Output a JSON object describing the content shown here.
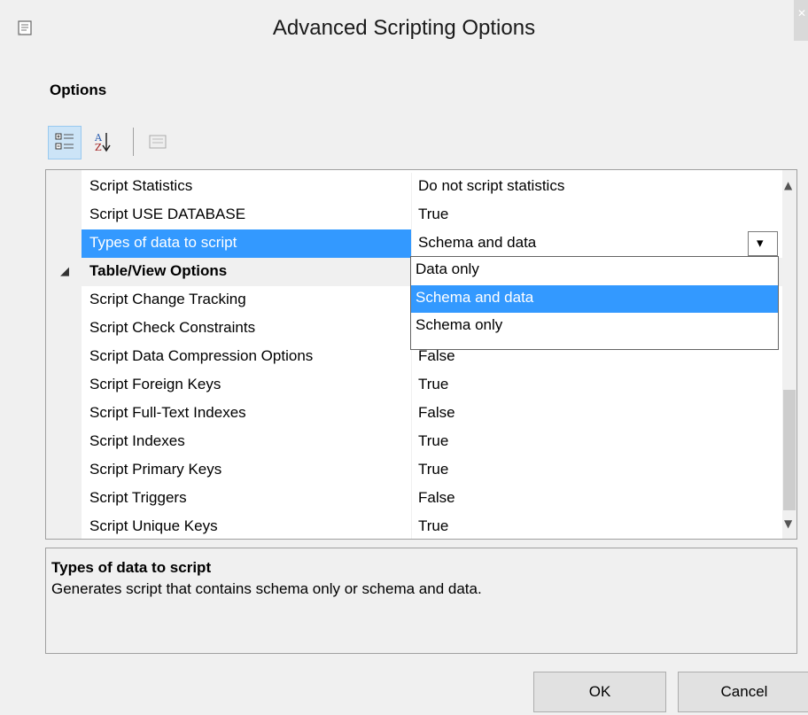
{
  "window": {
    "title": "Advanced Scripting Options"
  },
  "options_label": "Options",
  "toolbar": {
    "categorized_icon": "categorized-view-icon",
    "alphabetical_icon": "alphabetical-sort-icon",
    "property_pages_icon": "property-pages-icon"
  },
  "rows": [
    {
      "name": "Script Statistics",
      "value": "Do not script statistics"
    },
    {
      "name": "Script USE DATABASE",
      "value": "True"
    },
    {
      "name": "Types of data to script",
      "value": "Schema and data"
    },
    {
      "name": "Table/View Options",
      "value": ""
    },
    {
      "name": "Script Change Tracking",
      "value": ""
    },
    {
      "name": "Script Check Constraints",
      "value": ""
    },
    {
      "name": "Script Data Compression Options",
      "value": "False"
    },
    {
      "name": "Script Foreign Keys",
      "value": "True"
    },
    {
      "name": "Script Full-Text Indexes",
      "value": "False"
    },
    {
      "name": "Script Indexes",
      "value": "True"
    },
    {
      "name": "Script Primary Keys",
      "value": "True"
    },
    {
      "name": "Script Triggers",
      "value": "False"
    },
    {
      "name": "Script Unique Keys",
      "value": "True"
    }
  ],
  "dropdown": {
    "options": [
      "Data only",
      "Schema and data",
      "Schema only"
    ],
    "selected": "Schema and data"
  },
  "description": {
    "title": "Types of data to script",
    "text": "Generates script that contains schema only or schema and data."
  },
  "buttons": {
    "ok": "OK",
    "cancel": "Cancel"
  },
  "colors": {
    "selection": "#3399ff",
    "background": "#f0f0f0"
  }
}
